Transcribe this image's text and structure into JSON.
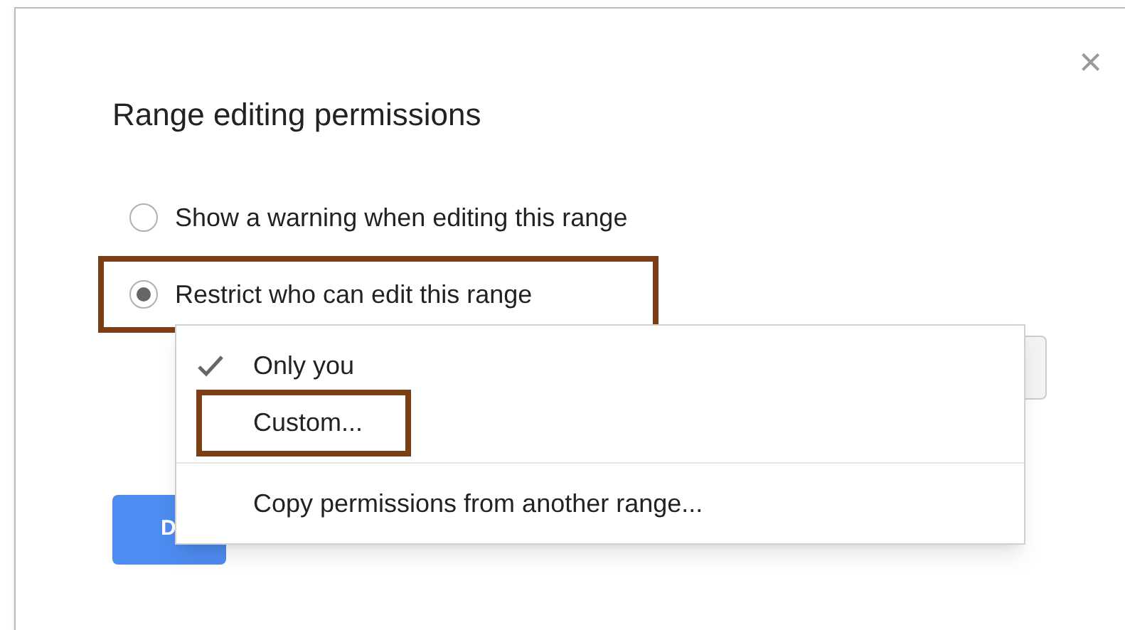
{
  "dialog": {
    "title": "Range editing permissions",
    "close": "×",
    "options": [
      {
        "label": "Show a warning when editing this range",
        "selected": false,
        "highlighted": false
      },
      {
        "label": "Restrict who can edit this range",
        "selected": true,
        "highlighted": true
      }
    ],
    "done_button": "D"
  },
  "menu": {
    "items": [
      {
        "kind": "option",
        "label": "Only you",
        "checked": true,
        "highlighted": false
      },
      {
        "kind": "option",
        "label": "Custom...",
        "checked": false,
        "highlighted": true
      },
      {
        "kind": "divider"
      },
      {
        "kind": "option",
        "label": "Copy permissions from another range...",
        "checked": false,
        "highlighted": false
      }
    ]
  }
}
